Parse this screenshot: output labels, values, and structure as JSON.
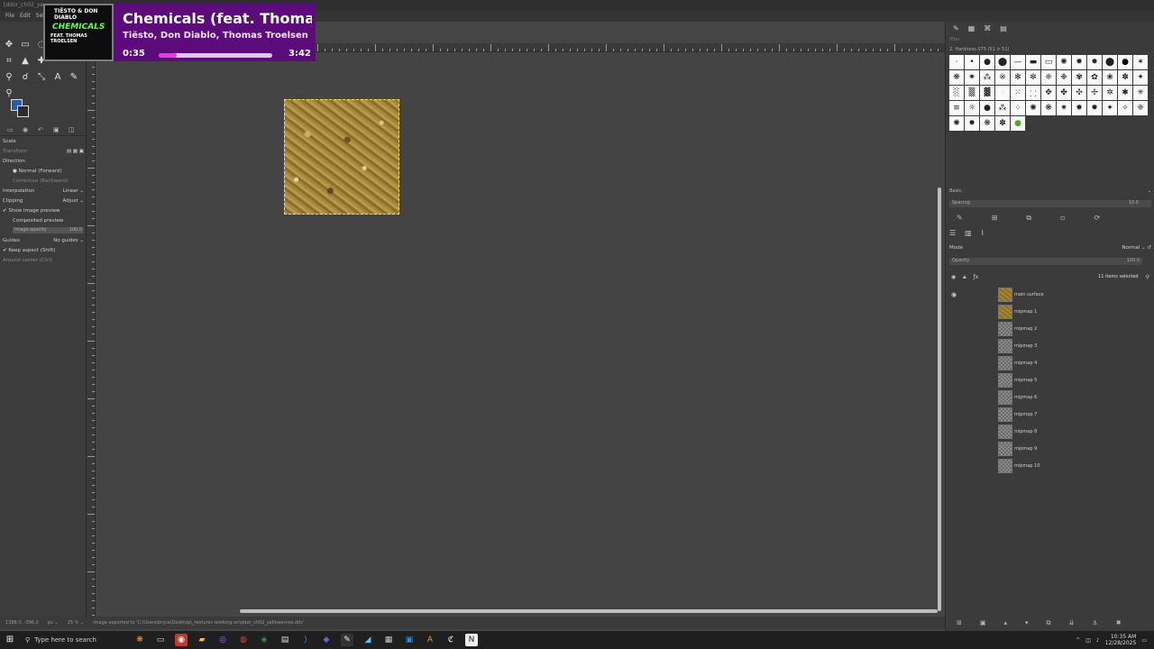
{
  "window": {
    "title": "[ddor_ch02_ye..."
  },
  "menu": [
    "File",
    "Edit",
    "Select"
  ],
  "tool_options": {
    "title": "Scale",
    "transform_label": "Transform",
    "direction_label": "Direction",
    "direction_normal": "Normal (Forward)",
    "direction_corrective": "Corrective (Backward)",
    "interpolation_label": "Interpolation",
    "interpolation_value": "Linear",
    "clipping_label": "Clipping",
    "clipping_value": "Adjust",
    "show_preview": "Show image preview",
    "composited_preview": "Composited preview",
    "image_opacity_label": "Image opacity",
    "image_opacity_value": "100.0",
    "guides_label": "Guides",
    "guides_value": "No guides",
    "keep_aspect": "Keep aspect (Shift)",
    "around_center": "Around center (Ctrl)"
  },
  "statusbar": {
    "coords": "1388.0, -396.0",
    "unit": "px",
    "zoom": "25 %",
    "message": "Image exported to 'C:\\Users\\bryce\\Desktop\\_textures working on\\ddor_ch02_yellowscree.dds'"
  },
  "brushes": {
    "filter_placeholder": "filter",
    "title": "2. Hardness 075 (51 × 51)",
    "preset": "Basic,",
    "spacing_label": "Spacing",
    "spacing_value": "10.0"
  },
  "layers": {
    "mode_label": "Mode",
    "mode_value": "Normal",
    "opacity_label": "Opacity",
    "opacity_value": "100.0",
    "selected_count": "11 items selected",
    "items": [
      {
        "name": "main surface",
        "visible": true,
        "thumb": "texture"
      },
      {
        "name": "mipmap 1",
        "visible": false,
        "thumb": "texture"
      },
      {
        "name": "mipmap 2",
        "visible": false,
        "thumb": "checker"
      },
      {
        "name": "mipmap 3",
        "visible": false,
        "thumb": "checker"
      },
      {
        "name": "mipmap 4",
        "visible": false,
        "thumb": "checker"
      },
      {
        "name": "mipmap 5",
        "visible": false,
        "thumb": "checker"
      },
      {
        "name": "mipmap 6",
        "visible": false,
        "thumb": "checker"
      },
      {
        "name": "mipmap 7",
        "visible": false,
        "thumb": "checker"
      },
      {
        "name": "mipmap 8",
        "visible": false,
        "thumb": "checker"
      },
      {
        "name": "mipmap 9",
        "visible": false,
        "thumb": "checker"
      },
      {
        "name": "mipmap 10",
        "visible": false,
        "thumb": "checker"
      }
    ]
  },
  "now_playing": {
    "title": "Chemicals (feat. Thomas Tr",
    "artist": "Tiësto, Don Diablo, Thomas Troelsen",
    "elapsed": "0:35",
    "total": "3:42",
    "progress": 0.16,
    "art_top": "TIËSTO & DON DIABLO",
    "art_main": "CHEMICALS",
    "art_bottom": "FEAT. THOMAS TROELSEN"
  },
  "taskbar": {
    "search_placeholder": "Type here to search",
    "time": "10:35 AM",
    "date": "12/28/2025"
  },
  "colors": {
    "foreground": "#1d5fb8",
    "background": "#2b2b2b",
    "accent": "#5b0b7a",
    "progress": "#e03ddc"
  }
}
